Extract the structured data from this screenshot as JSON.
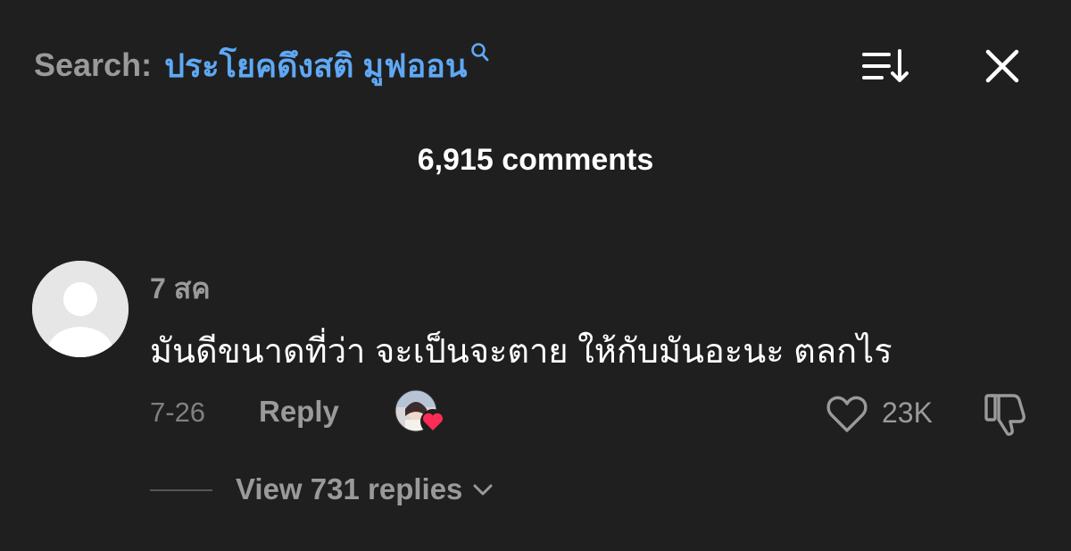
{
  "header": {
    "search_prefix": "Search:",
    "search_query": "ประโยคดึงสติ มูฟออน",
    "comments_count": "6,915 comments"
  },
  "comment": {
    "author": "7 สค",
    "text": "มันดีขนาดที่ว่า จะเป็นจะตาย ให้กับมันอะนะ ตลกไร",
    "date": "7-26",
    "reply_label": "Reply",
    "like_count": "23K",
    "view_replies_label": "View 731 replies"
  },
  "colors": {
    "background": "#1f1f1f",
    "search_query": "#5fa8f4",
    "muted_text": "#9a9a9a",
    "heart_badge": "#fe2c55"
  },
  "icons": {
    "search": "search-icon",
    "sort": "sort-icon",
    "close": "close-icon",
    "like": "heart-outline-icon",
    "dislike": "thumbs-down-icon",
    "chevron": "chevron-down-icon"
  }
}
